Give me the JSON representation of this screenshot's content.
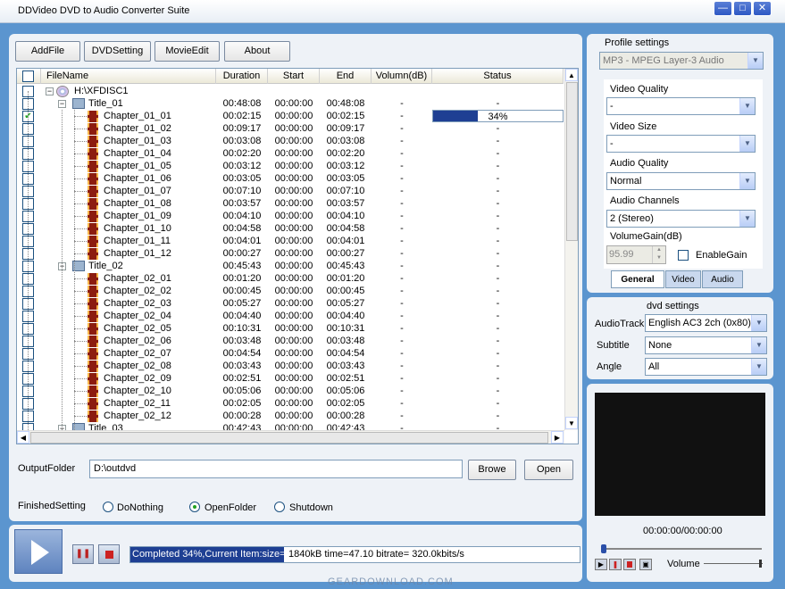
{
  "window": {
    "title": "DDVideo DVD to Audio Converter Suite"
  },
  "toolbar": {
    "addfile": "AddFile",
    "dvdsetting": "DVDSetting",
    "movieedit": "MovieEdit",
    "about": "About"
  },
  "table": {
    "headers": [
      "FileName",
      "Duration",
      "Start",
      "End",
      "Volumn(dB)",
      "Status"
    ],
    "progress_percent": 34,
    "rows": [
      {
        "type": "disc",
        "name": "H:\\XFDISC1",
        "duration": "",
        "start": "",
        "end": "",
        "vol": "",
        "status": "",
        "checked": false
      },
      {
        "type": "title",
        "name": "Title_01",
        "duration": "00:48:08",
        "start": "00:00:00",
        "end": "00:48:08",
        "vol": "-",
        "status": "-",
        "checked": false
      },
      {
        "type": "chapter",
        "name": "Chapter_01_01",
        "duration": "00:02:15",
        "start": "00:00:00",
        "end": "00:02:15",
        "vol": "-",
        "status": "34%",
        "checked": true,
        "progress": true
      },
      {
        "type": "chapter",
        "name": "Chapter_01_02",
        "duration": "00:09:17",
        "start": "00:00:00",
        "end": "00:09:17",
        "vol": "-",
        "status": "-",
        "checked": false
      },
      {
        "type": "chapter",
        "name": "Chapter_01_03",
        "duration": "00:03:08",
        "start": "00:00:00",
        "end": "00:03:08",
        "vol": "-",
        "status": "-",
        "checked": false
      },
      {
        "type": "chapter",
        "name": "Chapter_01_04",
        "duration": "00:02:20",
        "start": "00:00:00",
        "end": "00:02:20",
        "vol": "-",
        "status": "-",
        "checked": false
      },
      {
        "type": "chapter",
        "name": "Chapter_01_05",
        "duration": "00:03:12",
        "start": "00:00:00",
        "end": "00:03:12",
        "vol": "-",
        "status": "-",
        "checked": false
      },
      {
        "type": "chapter",
        "name": "Chapter_01_06",
        "duration": "00:03:05",
        "start": "00:00:00",
        "end": "00:03:05",
        "vol": "-",
        "status": "-",
        "checked": false
      },
      {
        "type": "chapter",
        "name": "Chapter_01_07",
        "duration": "00:07:10",
        "start": "00:00:00",
        "end": "00:07:10",
        "vol": "-",
        "status": "-",
        "checked": false
      },
      {
        "type": "chapter",
        "name": "Chapter_01_08",
        "duration": "00:03:57",
        "start": "00:00:00",
        "end": "00:03:57",
        "vol": "-",
        "status": "-",
        "checked": false
      },
      {
        "type": "chapter",
        "name": "Chapter_01_09",
        "duration": "00:04:10",
        "start": "00:00:00",
        "end": "00:04:10",
        "vol": "-",
        "status": "-",
        "checked": false
      },
      {
        "type": "chapter",
        "name": "Chapter_01_10",
        "duration": "00:04:58",
        "start": "00:00:00",
        "end": "00:04:58",
        "vol": "-",
        "status": "-",
        "checked": false
      },
      {
        "type": "chapter",
        "name": "Chapter_01_11",
        "duration": "00:04:01",
        "start": "00:00:00",
        "end": "00:04:01",
        "vol": "-",
        "status": "-",
        "checked": false
      },
      {
        "type": "chapter",
        "name": "Chapter_01_12",
        "duration": "00:00:27",
        "start": "00:00:00",
        "end": "00:00:27",
        "vol": "-",
        "status": "-",
        "checked": false
      },
      {
        "type": "title",
        "name": "Title_02",
        "duration": "00:45:43",
        "start": "00:00:00",
        "end": "00:45:43",
        "vol": "-",
        "status": "-",
        "checked": false
      },
      {
        "type": "chapter",
        "name": "Chapter_02_01",
        "duration": "00:01:20",
        "start": "00:00:00",
        "end": "00:01:20",
        "vol": "-",
        "status": "-",
        "checked": false
      },
      {
        "type": "chapter",
        "name": "Chapter_02_02",
        "duration": "00:00:45",
        "start": "00:00:00",
        "end": "00:00:45",
        "vol": "-",
        "status": "-",
        "checked": false
      },
      {
        "type": "chapter",
        "name": "Chapter_02_03",
        "duration": "00:05:27",
        "start": "00:00:00",
        "end": "00:05:27",
        "vol": "-",
        "status": "-",
        "checked": false
      },
      {
        "type": "chapter",
        "name": "Chapter_02_04",
        "duration": "00:04:40",
        "start": "00:00:00",
        "end": "00:04:40",
        "vol": "-",
        "status": "-",
        "checked": false
      },
      {
        "type": "chapter",
        "name": "Chapter_02_05",
        "duration": "00:10:31",
        "start": "00:00:00",
        "end": "00:10:31",
        "vol": "-",
        "status": "-",
        "checked": false
      },
      {
        "type": "chapter",
        "name": "Chapter_02_06",
        "duration": "00:03:48",
        "start": "00:00:00",
        "end": "00:03:48",
        "vol": "-",
        "status": "-",
        "checked": false
      },
      {
        "type": "chapter",
        "name": "Chapter_02_07",
        "duration": "00:04:54",
        "start": "00:00:00",
        "end": "00:04:54",
        "vol": "-",
        "status": "-",
        "checked": false
      },
      {
        "type": "chapter",
        "name": "Chapter_02_08",
        "duration": "00:03:43",
        "start": "00:00:00",
        "end": "00:03:43",
        "vol": "-",
        "status": "-",
        "checked": false
      },
      {
        "type": "chapter",
        "name": "Chapter_02_09",
        "duration": "00:02:51",
        "start": "00:00:00",
        "end": "00:02:51",
        "vol": "-",
        "status": "-",
        "checked": false
      },
      {
        "type": "chapter",
        "name": "Chapter_02_10",
        "duration": "00:05:06",
        "start": "00:00:00",
        "end": "00:05:06",
        "vol": "-",
        "status": "-",
        "checked": false
      },
      {
        "type": "chapter",
        "name": "Chapter_02_11",
        "duration": "00:02:05",
        "start": "00:00:00",
        "end": "00:02:05",
        "vol": "-",
        "status": "-",
        "checked": false
      },
      {
        "type": "chapter",
        "name": "Chapter_02_12",
        "duration": "00:00:28",
        "start": "00:00:00",
        "end": "00:00:28",
        "vol": "-",
        "status": "-",
        "checked": false
      },
      {
        "type": "title",
        "name": "Title_03",
        "duration": "00:42:43",
        "start": "00:00:00",
        "end": "00:42:43",
        "vol": "-",
        "status": "-",
        "checked": false
      }
    ]
  },
  "output": {
    "label": "OutputFolder",
    "value": "D:\\outdvd",
    "browse": "Browe",
    "open": "Open"
  },
  "finished": {
    "label": "FinishedSetting",
    "options": [
      "DoNothing",
      "OpenFolder",
      "Shutdown"
    ],
    "selected": "OpenFolder"
  },
  "statusbar": {
    "left": "Completed 34%,Current Item:size=",
    "right": "1840kB time=47.10 bitrate= 320.0kbits/s"
  },
  "profile": {
    "heading": "Profile settings",
    "value": "MP3 - MPEG Layer-3 Audio",
    "video_quality_label": "Video Quality",
    "video_quality": "-",
    "video_size_label": "Video Size",
    "video_size": "-",
    "audio_quality_label": "Audio Quality",
    "audio_quality": "Normal",
    "audio_channels_label": "Audio Channels",
    "audio_channels": "2 (Stereo)",
    "volumegain_label": "VolumeGain(dB)",
    "volumegain": "95.99",
    "enablegain": "EnableGain",
    "tabs": [
      "General",
      "Video",
      "Audio"
    ]
  },
  "dvd": {
    "heading": "dvd settings",
    "audiotrack_label": "AudioTrack",
    "audiotrack": "English AC3 2ch (0x80)",
    "subtitle_label": "Subtitle",
    "subtitle": "None",
    "angle_label": "Angle",
    "angle": "All"
  },
  "preview": {
    "time": "00:00:00/00:00:00",
    "volume_label": "Volume"
  },
  "watermark": "GEARDOWNLOAD.COM",
  "colors": {
    "frame": "#5b95cf",
    "panel": "#eef2f7",
    "progress": "#1e3f93"
  }
}
